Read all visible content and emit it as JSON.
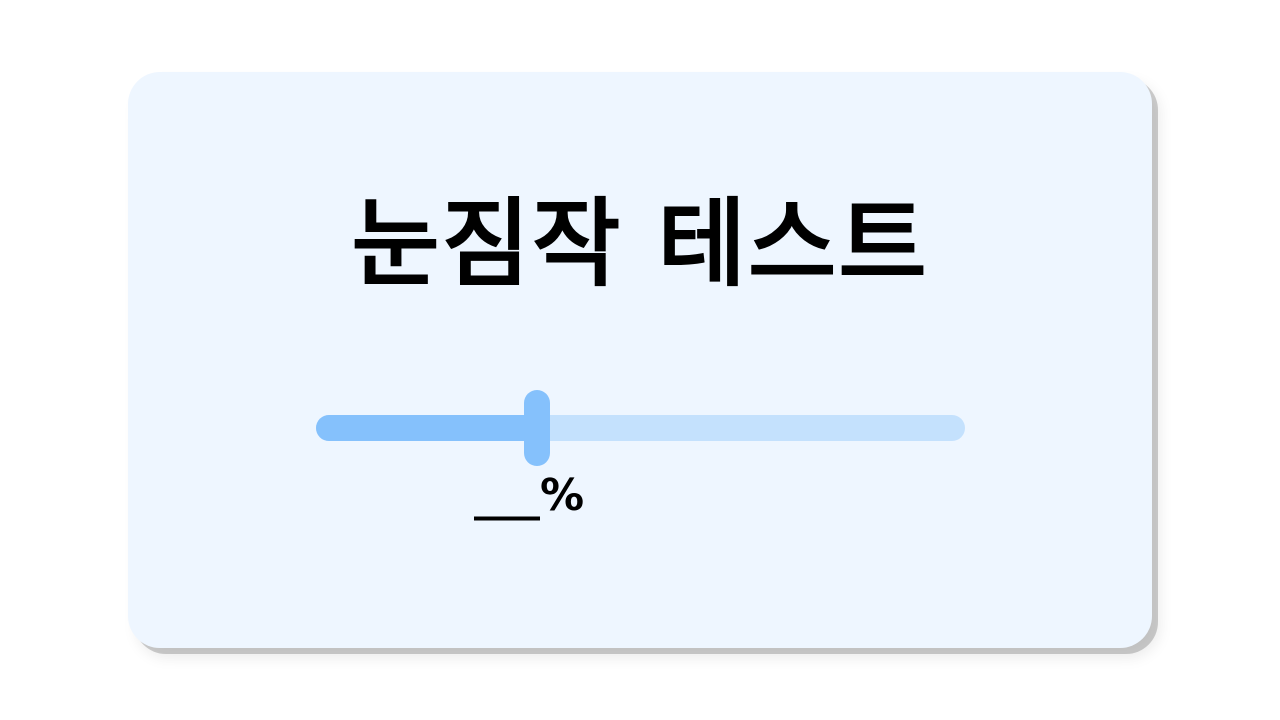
{
  "card": {
    "title": "눈짐작 테스트"
  },
  "slider": {
    "value_fraction": 0.34,
    "readout": "___%"
  },
  "colors": {
    "card_background": "#eef6ff",
    "track": "#c4e1fd",
    "fill": "#85c1fc",
    "thumb": "#85c1fc",
    "text": "#000000"
  }
}
